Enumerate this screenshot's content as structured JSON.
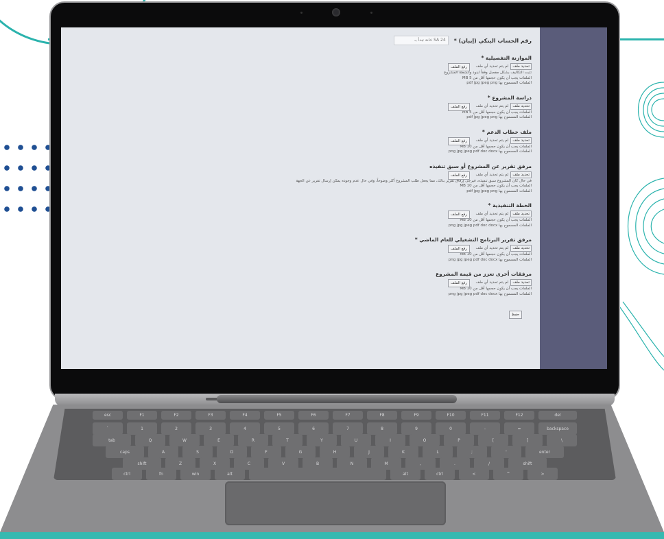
{
  "form": {
    "account_label": "رقم الحساب البنكي (إيبان) *",
    "account_placeholder": "SA  24 خانة تبدأ بـ",
    "choose_file_label": "تحديد ملف",
    "no_file_label": "لم يتم تحديد أي ملف",
    "upload_label": "رفع الملف",
    "sections": [
      {
        "title": "الموازنة التفصيلية *",
        "hints": [
          "تثبت التكاليف بشكل مفصل وفقاً لبنود وأنشطة المشروع",
          "الملفات يجب أن يكون حجمها أقل من 5 MB",
          "الملفات المسموح بها pdf jpg jpeg png"
        ]
      },
      {
        "title": "دراسة المشروع *",
        "hints": [
          "الملفات يجب أن يكون حجمها أقل من 5 MB",
          "الملفات المسموح بها pdf jpg jpeg png"
        ]
      },
      {
        "title": "ملف خطاب الدعم *",
        "hints": [
          "الملفات يجب أن يكون حجمها أقل من 10 MB",
          "الملفات المسموح بها png jpg jpeg pdf doc docx"
        ]
      },
      {
        "title": "مرفق تقرير عن المشروع أو سبق تنفيذه",
        "hints": [
          "في حال كان المشروع سبق تنفيذه، فيرجى إرفاق تقرير بذلك، مما يجعل طلب المشروع أكثر وضوحاً، وفي حال عدم وجوده يمكن إرسال تقرير عن الجهة",
          "الملفات يجب أن يكون حجمها أقل من 10 MB",
          "الملفات المسموح بها pdf jpg jpeg png"
        ]
      },
      {
        "title": "الخطة التنفيذية *",
        "hints": [
          "الملفات يجب أن يكون حجمها أقل من 10 MB",
          "الملفات المسموح بها png jpg jpeg pdf doc docx"
        ]
      },
      {
        "title": "مرفق تقرير البرنامج التشغيلي للعام الماضي *",
        "hints": [
          "الملفات يجب أن يكون حجمها أقل من 10 MB",
          "الملفات المسموح بها png jpg jpeg pdf doc docx"
        ]
      },
      {
        "title": "مرفقات أخرى تعزز من قيمة المشروع",
        "hints": [
          "الملفات يجب أن يكون حجمها أقل من 10 MB",
          "الملفات المسموح بها png jpg jpeg pdf doc docx"
        ]
      }
    ],
    "submit_label": "حفظ"
  },
  "keyboard": {
    "rows": [
      [
        "esc",
        "F1",
        "F2",
        "F3",
        "F4",
        "F5",
        "F6",
        "F7",
        "F8",
        "F9",
        "F10",
        "F11",
        "F12",
        "del"
      ],
      [
        "`",
        "1",
        "2",
        "3",
        "4",
        "5",
        "6",
        "7",
        "8",
        "9",
        "0",
        "-",
        "=",
        "backspace"
      ],
      [
        "tab",
        "Q",
        "W",
        "E",
        "R",
        "T",
        "Y",
        "U",
        "I",
        "O",
        "P",
        "[",
        "]",
        "\\"
      ],
      [
        "caps",
        "A",
        "S",
        "D",
        "F",
        "G",
        "H",
        "J",
        "K",
        "L",
        ";",
        "'",
        "enter"
      ],
      [
        "shift",
        "Z",
        "X",
        "C",
        "V",
        "B",
        "N",
        "M",
        ",",
        ".",
        "/",
        "shift"
      ],
      [
        "ctrl",
        "fn",
        "win",
        "alt",
        "",
        "alt",
        "ctrl",
        "<",
        "^",
        ">"
      ]
    ]
  },
  "colors": {
    "teal": "#2bb3ad",
    "dots": "#1f4f93",
    "screen_bg": "#e4e7ec",
    "sidebar": "#5a5c7a"
  }
}
